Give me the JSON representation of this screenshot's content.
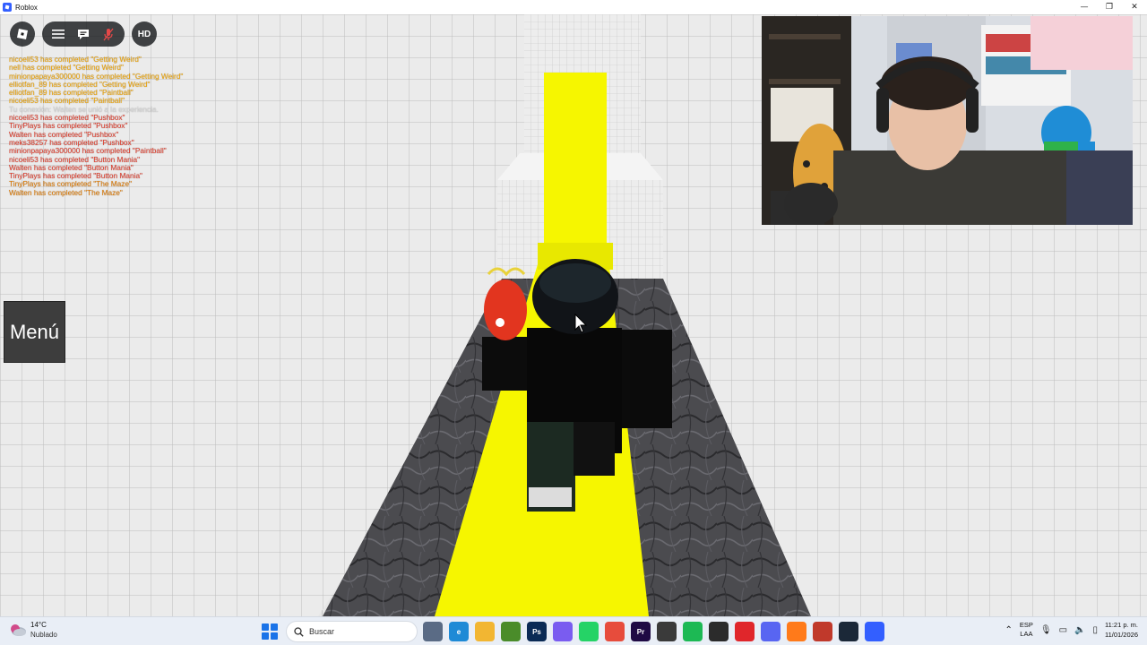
{
  "window": {
    "title": "Roblox",
    "controls": {
      "minimize": "—",
      "maximize": "❐",
      "close": "✕"
    }
  },
  "topbar": {
    "hd_label": "HD"
  },
  "chat": {
    "messages": [
      {
        "text": "nicoeli53 has completed \"Getting Weird\"",
        "color": "#f0a400"
      },
      {
        "text": "nell has completed \"Getting Weird\"",
        "color": "#f0a400"
      },
      {
        "text": "minionpapaya300000 has completed \"Getting Weird\"",
        "color": "#f0a400"
      },
      {
        "text": "elliotfan_89 has completed \"Getting Weird\"",
        "color": "#f0a400"
      },
      {
        "text": "elliotfan_89 has completed \"Paintball\"",
        "color": "#f0a400"
      },
      {
        "text": "nicoeli53 has completed \"Paintball\"",
        "color": "#f0a400"
      },
      {
        "text": "Tu conexión: Walten se unió a la experiencia.",
        "color": "#d8d8d8"
      },
      {
        "text": "nicoeli53 has completed \"Pushbox\"",
        "color": "#e33b2a"
      },
      {
        "text": "TinyPlays has completed \"Pushbox\"",
        "color": "#e33b2a"
      },
      {
        "text": "Walten has completed \"Pushbox\"",
        "color": "#e33b2a"
      },
      {
        "text": "meks38257 has completed \"Pushbox\"",
        "color": "#e33b2a"
      },
      {
        "text": "minionpapaya300000 has completed \"Paintball\"",
        "color": "#e33b2a"
      },
      {
        "text": "nicoeli53 has completed \"Button Mania\"",
        "color": "#e33b2a"
      },
      {
        "text": "Walten has completed \"Button Mania\"",
        "color": "#e33b2a"
      },
      {
        "text": "TinyPlays has completed \"Button Mania\"",
        "color": "#e33b2a"
      },
      {
        "text": "TinyPlays has completed \"The Maze\"",
        "color": "#e07a00"
      },
      {
        "text": "Walten has completed \"The Maze\"",
        "color": "#e07a00"
      }
    ]
  },
  "menu": {
    "label": "Menú"
  },
  "taskbar": {
    "weather": {
      "temp": "14°C",
      "condition": "Nublado"
    },
    "search": {
      "placeholder": "Buscar"
    },
    "apps": [
      {
        "name": "task-view",
        "label": "",
        "color": "#5a6b85"
      },
      {
        "name": "edge",
        "label": "e",
        "color": "#1e8ad6"
      },
      {
        "name": "file-explorer",
        "label": "",
        "color": "#f2b632"
      },
      {
        "name": "minecraft",
        "label": "",
        "color": "#4a8c2a"
      },
      {
        "name": "photoshop",
        "label": "Ps",
        "color": "#0a2a55"
      },
      {
        "name": "copilot",
        "label": "",
        "color": "#7a5cf0"
      },
      {
        "name": "whatsapp",
        "label": "",
        "color": "#25d366"
      },
      {
        "name": "chrome",
        "label": "",
        "color": "#e74c3c"
      },
      {
        "name": "premiere",
        "label": "Pr",
        "color": "#1f0a44"
      },
      {
        "name": "store",
        "label": "",
        "color": "#3a3a3a"
      },
      {
        "name": "spotify",
        "label": "",
        "color": "#1db954"
      },
      {
        "name": "obs",
        "label": "",
        "color": "#2b2b2b"
      },
      {
        "name": "opera",
        "label": "",
        "color": "#e0262b"
      },
      {
        "name": "discord",
        "label": "",
        "color": "#5865f2"
      },
      {
        "name": "firefox",
        "label": "",
        "color": "#ff7a1a"
      },
      {
        "name": "mixer-app",
        "label": "",
        "color": "#c0392b"
      },
      {
        "name": "steam",
        "label": "",
        "color": "#1b2838"
      },
      {
        "name": "roblox",
        "label": "",
        "color": "#335fff"
      }
    ],
    "tray": {
      "lang_top": "ESP",
      "lang_bottom": "LAA",
      "time": "11:21 p. m.",
      "date": "11/01/2026"
    }
  },
  "colors": {
    "track_yellow": "#f6f600",
    "floor_dark": "#4a4a4d",
    "wall_light": "#e6e6e6"
  }
}
